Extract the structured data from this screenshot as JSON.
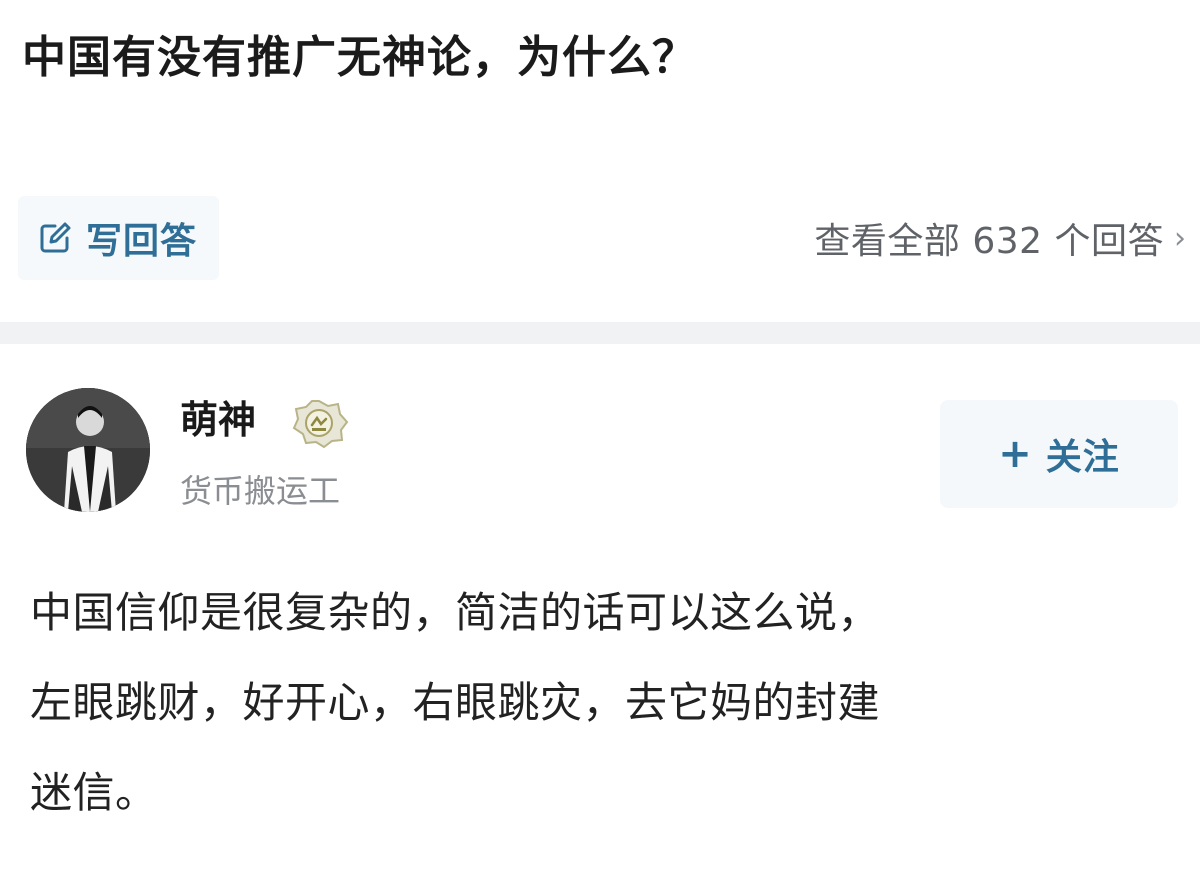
{
  "question": {
    "title": "中国有没有推广无神论，为什么？"
  },
  "actions": {
    "write_answer_label": "写回答",
    "view_all_label": "查看全部 632 个回答",
    "view_all_chevron": "›",
    "icons": {
      "write": "edit-icon",
      "chevron": "chevron-right-icon"
    }
  },
  "answer": {
    "author": {
      "name": "萌神",
      "bio": "货币搬运工",
      "avatar_icon": "avatar",
      "badge_icon": "badge-icon"
    },
    "follow": {
      "plus": "+",
      "label": "关注"
    },
    "content_lines": [
      "中国信仰是很复杂的，简洁的话可以这么说，",
      "左眼跳财，好开心，右眼跳灾，去它妈的封建",
      "迷信。"
    ]
  },
  "colors": {
    "accent": "#2f6e96",
    "text_primary": "#1a1a1a",
    "text_secondary": "#8a8d91",
    "divider": "#f1f2f4",
    "button_bg": "#f5f8fb"
  }
}
